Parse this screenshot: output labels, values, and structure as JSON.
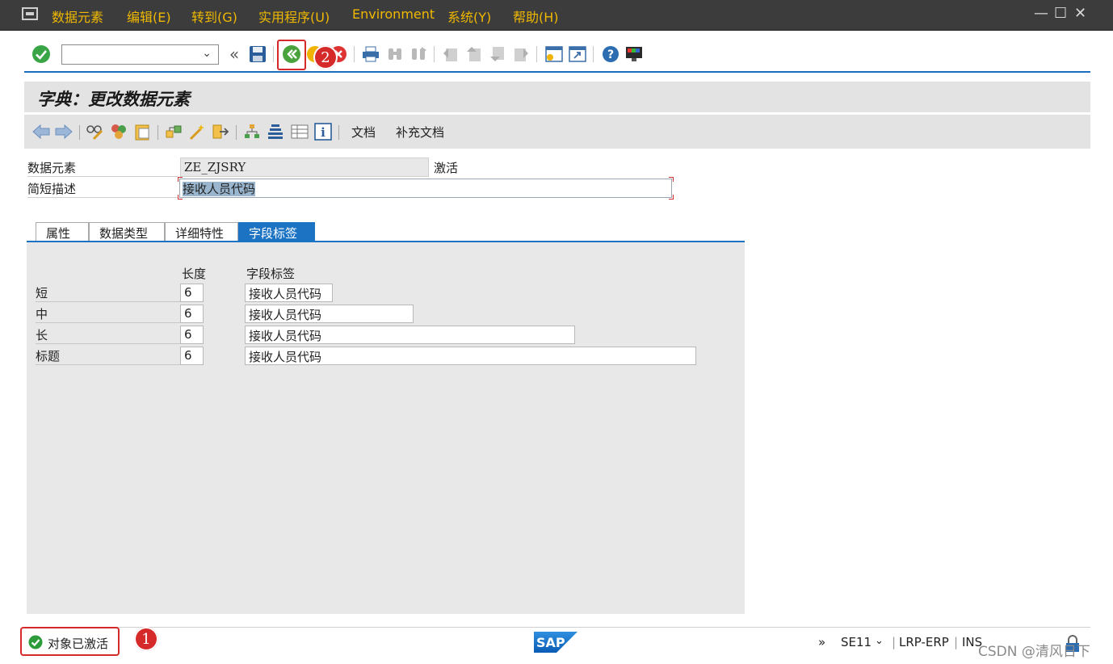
{
  "menu": {
    "items": [
      "数据元素",
      "编辑(E)",
      "转到(G)",
      "实用程序(U)",
      "Environment",
      "系统(Y)",
      "帮助(H)"
    ],
    "window_controls": [
      "—",
      "☐",
      "✕"
    ]
  },
  "toolbar": {
    "command_field_value": "",
    "back_glyph": "«"
  },
  "title": "字典：更改数据元素",
  "app_toolbar": {
    "documentation": "文档",
    "supplementary_documentation": "补充文档"
  },
  "header": {
    "data_element_label": "数据元素",
    "data_element_value": "ZE_ZJSRY",
    "status": "激活",
    "short_description_label": "简短描述",
    "short_description_value": "接收人员代码"
  },
  "tabs": [
    {
      "label": "属性",
      "active": false
    },
    {
      "label": "数据类型",
      "active": false
    },
    {
      "label": "详细特性",
      "active": false
    },
    {
      "label": "字段标签",
      "active": true
    }
  ],
  "field_labels": {
    "col_length": "长度",
    "col_label": "字段标签",
    "rows": [
      {
        "name": "短",
        "length": "6",
        "label": "接收人员代码"
      },
      {
        "name": "中",
        "length": "6",
        "label": "接收人员代码"
      },
      {
        "name": "长",
        "length": "6",
        "label": "接收人员代码"
      },
      {
        "name": "标题",
        "length": "6",
        "label": "接收人员代码"
      }
    ]
  },
  "status_bar": {
    "message": "对象已激活",
    "more": "»",
    "transaction": "SE11",
    "system": "LRP-ERP",
    "mode": "INS"
  },
  "annotations": {
    "badge_1": "1",
    "badge_2": "2"
  },
  "watermark": "CSDN @清风日下",
  "colors": {
    "menubar_bg": "#3c3c3c",
    "menu_text": "#f0b800",
    "accent_blue": "#1c73c3",
    "annotation_red": "#d62a2a",
    "success_green": "#2e9b3a"
  },
  "icons": {
    "enter": "check-circle-icon",
    "save": "save-icon",
    "activate": "activate-icon",
    "exit": "exit-icon",
    "cancel": "cancel-icon",
    "print": "print-icon",
    "find": "find-icon",
    "help": "help-icon"
  }
}
